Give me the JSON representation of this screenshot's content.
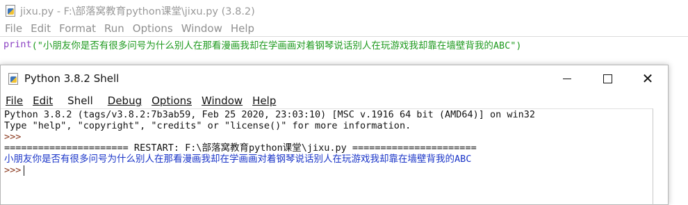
{
  "editor": {
    "title": "jixu.py - F:\\部落窝教育python课堂\\jixu.py (3.8.2)",
    "menu": [
      "File",
      "Edit",
      "Format",
      "Run",
      "Options",
      "Window",
      "Help"
    ],
    "code_fn": "print",
    "code_str": "(\"小朋友你是否有很多问号为什么别人在那看漫画我却在学画画对着钢琴说话别人在玩游戏我却靠在墙壁背我的ABC\")"
  },
  "shell": {
    "title": "Python 3.8.2 Shell",
    "controls": {
      "minimize": "–",
      "maximize": "□",
      "close": "✕"
    },
    "menu": [
      "File",
      "Edit",
      "Shell",
      "Debug",
      "Options",
      "Window",
      "Help"
    ],
    "lines": {
      "banner1": "Python 3.8.2 (tags/v3.8.2:7b3ab59, Feb 25 2020, 23:03:10) [MSC v.1916 64 bit (AMD64)] on win32",
      "banner2": "Type \"help\", \"copyright\", \"credits\" or \"license()\" for more information.",
      "prompt1": ">>>",
      "restart": "====================== RESTART: F:\\部落窝教育python课堂\\jixu.py ======================",
      "output": "小朋友你是否有很多问号为什么别人在那看漫画我却在学画画对着钢琴说话别人在玩游戏我却靠在墙壁背我的ABC",
      "prompt2": ">>>"
    }
  },
  "colors": {
    "prompt": "#8b3a1f",
    "output": "#1a35c8",
    "keyword_fn": "#8a3fc2",
    "string": "#1f9a1f"
  },
  "icons": [
    "python-file-icon",
    "minimize-icon",
    "maximize-icon",
    "close-icon"
  ]
}
